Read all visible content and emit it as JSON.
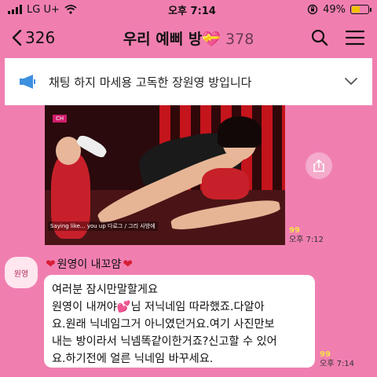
{
  "status_bar": {
    "carrier": "LG U+",
    "time": "오후 7:14",
    "battery_percent": "49%",
    "battery_level": 0.49
  },
  "header": {
    "back_count": "326",
    "title": "우리 예삐 방",
    "title_emoji": "💝",
    "member_count": "378",
    "icons": [
      "back-chevron-icon",
      "heart-gift-icon",
      "search-icon",
      "menu-icon"
    ]
  },
  "notice": {
    "icon": "megaphone-icon",
    "text": "채팅 하지 마세용 고독한 장원영 방입니다"
  },
  "photo_message": {
    "overlay_caption": "Saying like... you up 다로그 / 그리 사방에",
    "unread": "99",
    "time": "오후 7:12"
  },
  "text_message": {
    "sender": "원영이 내꼬얌",
    "avatar_label": "원영",
    "lines": [
      "여러분 잠시만말할게요",
      "원영이 내꺼야💕님 저닉네임 따라했죠.다알아",
      "요.원래 닉네임그거 아니였던거요.여기 사진만보",
      "내는 방이라서 닉넴똑같이한거죠?신고할 수 있어",
      "요.하기전에 얼른 닉네임 바꾸세요."
    ],
    "unread": "99",
    "time": "오후 7:14"
  },
  "colors": {
    "background": "#f07fb0",
    "unread": "#f5e04a"
  }
}
